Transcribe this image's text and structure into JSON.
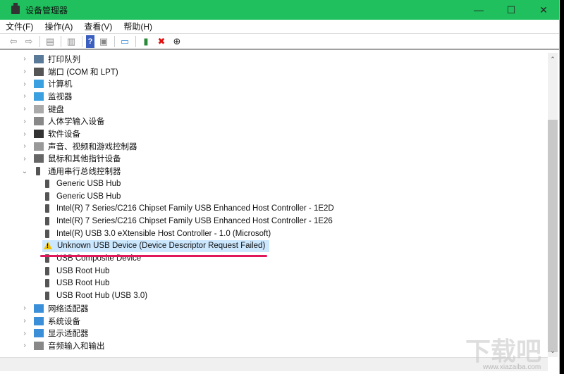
{
  "window": {
    "title": "设备管理器",
    "minimize": "—",
    "maximize": "☐",
    "close": "✕"
  },
  "menu": [
    "文件(F)",
    "操作(A)",
    "查看(V)",
    "帮助(H)"
  ],
  "toolbar": [
    "back",
    "forward",
    "properties",
    "view",
    "help",
    "action",
    "monitor",
    "update-driver",
    "uninstall",
    "disable"
  ],
  "tree": [
    {
      "label": "打印队列",
      "level": 0,
      "expanded": false,
      "icon": "printer"
    },
    {
      "label": "端口 (COM 和 LPT)",
      "level": 0,
      "expanded": false,
      "icon": "port"
    },
    {
      "label": "计算机",
      "level": 0,
      "expanded": false,
      "icon": "computer"
    },
    {
      "label": "监视器",
      "level": 0,
      "expanded": false,
      "icon": "monitor"
    },
    {
      "label": "键盘",
      "level": 0,
      "expanded": false,
      "icon": "keyboard"
    },
    {
      "label": "人体学输入设备",
      "level": 0,
      "expanded": false,
      "icon": "hid"
    },
    {
      "label": "软件设备",
      "level": 0,
      "expanded": false,
      "icon": "software"
    },
    {
      "label": "声音、视频和游戏控制器",
      "level": 0,
      "expanded": false,
      "icon": "speaker"
    },
    {
      "label": "鼠标和其他指针设备",
      "level": 0,
      "expanded": false,
      "icon": "mouse"
    },
    {
      "label": "通用串行总线控制器",
      "level": 0,
      "expanded": true,
      "icon": "usb"
    },
    {
      "label": "Generic USB Hub",
      "level": 1,
      "icon": "usb"
    },
    {
      "label": "Generic USB Hub",
      "level": 1,
      "icon": "usb"
    },
    {
      "label": "Intel(R) 7 Series/C216 Chipset Family USB Enhanced Host Controller - 1E2D",
      "level": 1,
      "icon": "usb"
    },
    {
      "label": "Intel(R) 7 Series/C216 Chipset Family USB Enhanced Host Controller - 1E26",
      "level": 1,
      "icon": "usb"
    },
    {
      "label": "Intel(R) USB 3.0 eXtensible Host Controller - 1.0 (Microsoft)",
      "level": 1,
      "icon": "usb"
    },
    {
      "label": "Unknown USB Device (Device Descriptor Request Failed)",
      "level": 1,
      "icon": "warning",
      "selected": true
    },
    {
      "label": "USB Composite Device",
      "level": 1,
      "icon": "usb"
    },
    {
      "label": "USB Root Hub",
      "level": 1,
      "icon": "usb"
    },
    {
      "label": "USB Root Hub",
      "level": 1,
      "icon": "usb"
    },
    {
      "label": "USB Root Hub (USB 3.0)",
      "level": 1,
      "icon": "usb"
    },
    {
      "label": "网络适配器",
      "level": 0,
      "expanded": false,
      "icon": "network"
    },
    {
      "label": "系统设备",
      "level": 0,
      "expanded": false,
      "icon": "system"
    },
    {
      "label": "显示适配器",
      "level": 0,
      "expanded": false,
      "icon": "display"
    },
    {
      "label": "音频输入和输出",
      "level": 0,
      "expanded": false,
      "icon": "audio"
    }
  ],
  "watermark": {
    "logo": "下载吧",
    "url": "www.xiazaiba.com"
  },
  "colors": {
    "titlebar": "#20c05e",
    "selection": "#cce8ff",
    "annotation": "#e0185a"
  }
}
